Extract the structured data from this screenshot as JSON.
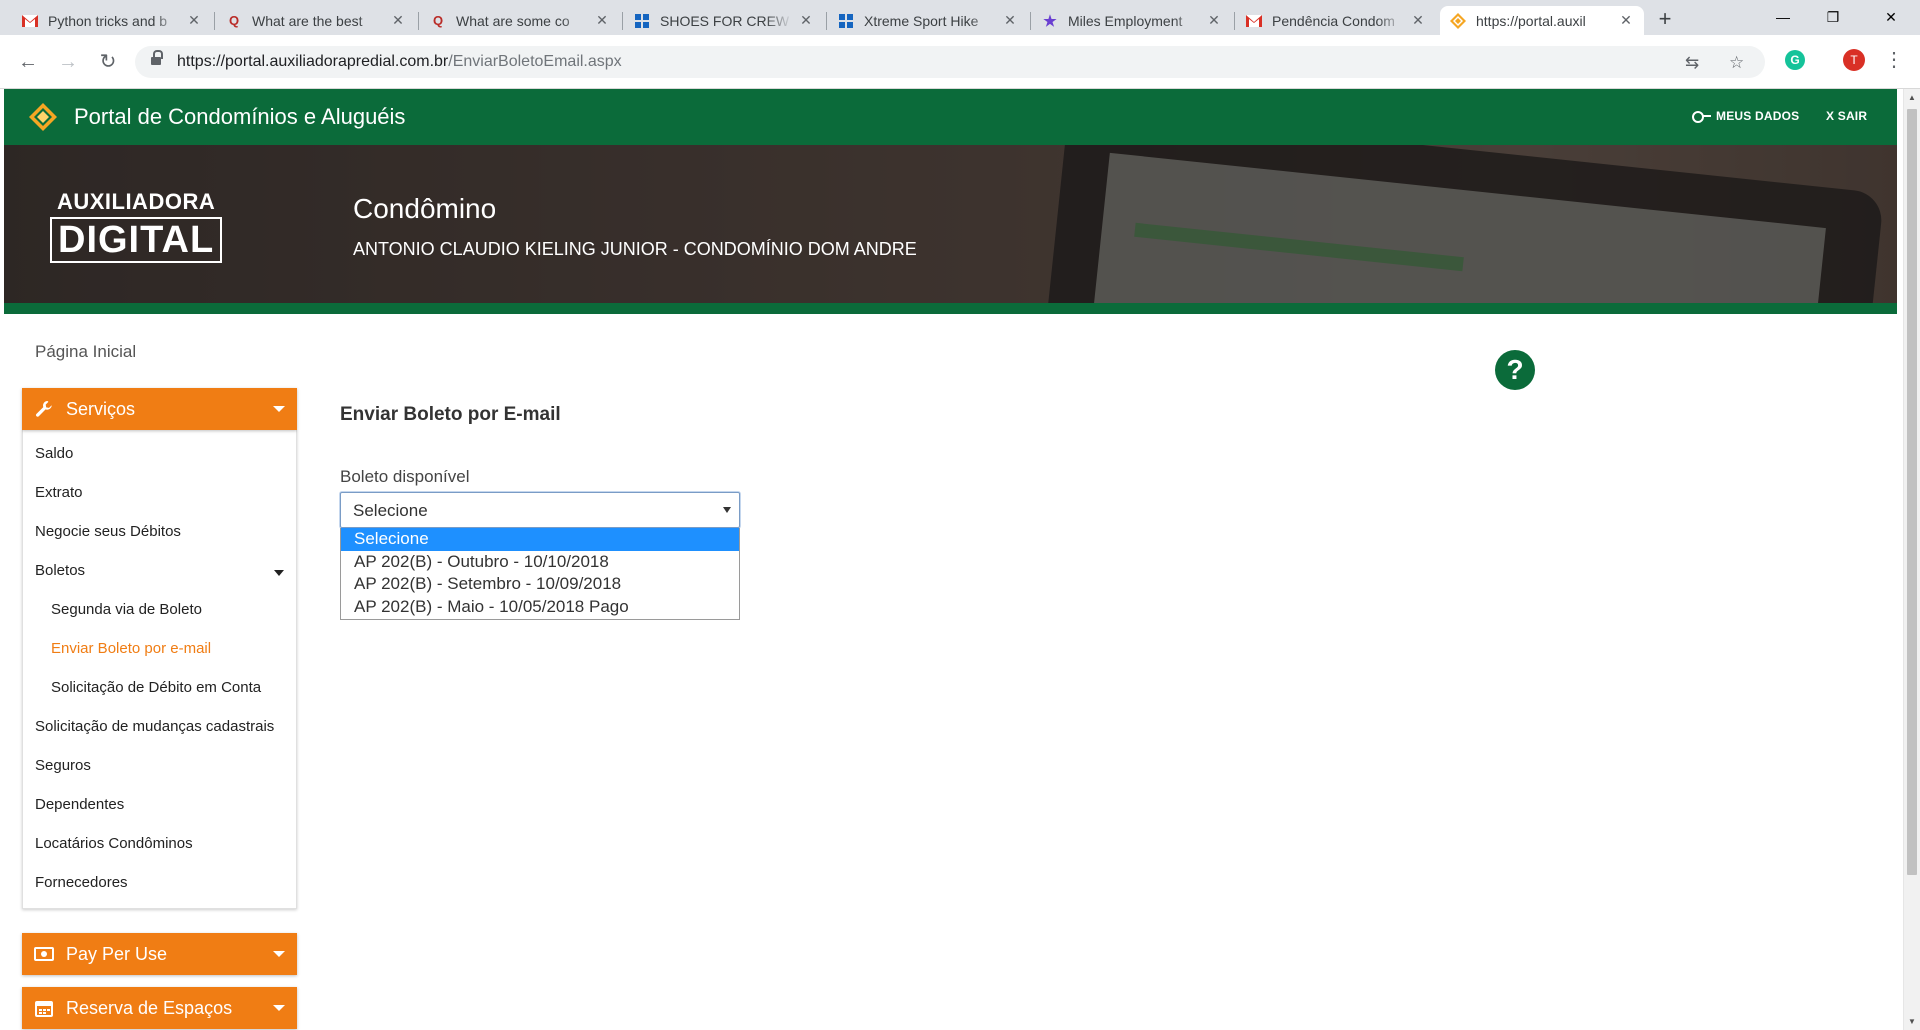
{
  "browser": {
    "tabs": [
      {
        "title": "Python tricks and b",
        "icon": "gmail-icon"
      },
      {
        "title": "What are the best",
        "icon": "quora-icon"
      },
      {
        "title": "What are some co",
        "icon": "quora-icon"
      },
      {
        "title": "SHOES FOR CREW",
        "icon": "globe-icon"
      },
      {
        "title": "Xtreme Sport Hike",
        "icon": "globe-icon"
      },
      {
        "title": "Miles Employment",
        "icon": "star-icon"
      },
      {
        "title": "Pendência Condom",
        "icon": "gmail-icon"
      },
      {
        "title": "https://portal.auxil",
        "icon": "portal-diamond-icon",
        "active": true
      }
    ],
    "url_host": "https://portal.auxiliadorapredial.com.br",
    "url_path": "/EnviarBoletoEmail.aspx",
    "profile_initial": "T",
    "extension_initial": "G"
  },
  "header": {
    "brand_title": "Portal de Condomínios e Aluguéis",
    "nav_my_data": "MEUS DADOS",
    "nav_logout": "X SAIR"
  },
  "hero": {
    "logo_line1": "AUXILIADORA",
    "logo_line2": "DIGITAL",
    "role": "Condômino",
    "name": "ANTONIO CLAUDIO KIELING JUNIOR - CONDOMÍNIO DOM ANDRE"
  },
  "breadcrumb": "Página Inicial",
  "sidebar": {
    "services_label": "Serviços",
    "items": [
      {
        "label": "Saldo"
      },
      {
        "label": "Extrato"
      },
      {
        "label": "Negocie seus Débitos"
      },
      {
        "label": "Boletos"
      },
      {
        "label": "Segunda via de Boleto"
      },
      {
        "label": "Enviar Boleto por e-mail"
      },
      {
        "label": "Solicitação de Débito em Conta"
      },
      {
        "label": "Solicitação de mudanças cadastrais"
      },
      {
        "label": "Seguros"
      },
      {
        "label": "Dependentes"
      },
      {
        "label": "Locatários Condôminos"
      },
      {
        "label": "Fornecedores"
      }
    ],
    "pay_per_use_label": "Pay Per Use",
    "reserva_label": "Reserva de Espaços"
  },
  "main": {
    "title": "Enviar Boleto por E-mail",
    "field_label": "Boleto disponível",
    "selected_value": "Selecione",
    "options": [
      "Selecione",
      "AP 202(B) - Outubro - 10/10/2018",
      "AP 202(B) - Setembro - 10/09/2018",
      "AP 202(B) - Maio - 10/05/2018 Pago"
    ],
    "help_symbol": "?"
  },
  "colors": {
    "brand_green": "#0b6b3a",
    "accent_orange": "#f07d14",
    "option_highlight": "#1e90ff"
  }
}
